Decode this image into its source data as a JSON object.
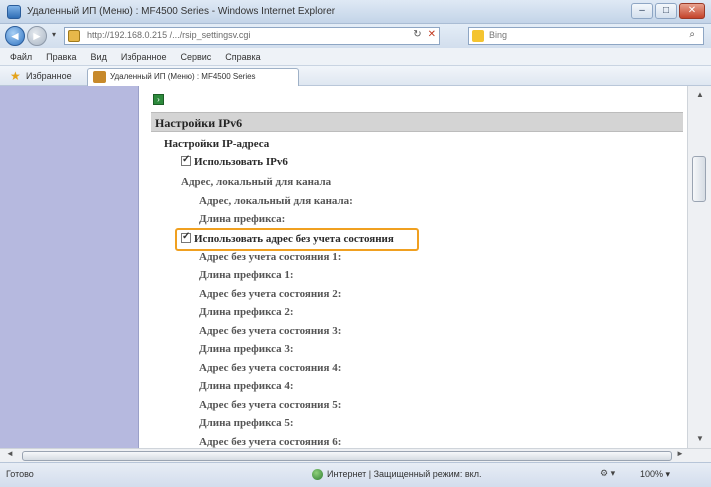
{
  "window": {
    "title": "Удаленный ИП (Меню) : MF4500 Series - Windows Internet Explorer",
    "min": "–",
    "max": "□",
    "close": "✕"
  },
  "nav": {
    "back": "◄",
    "forward": "►",
    "dropdown": "▾",
    "url": "http://192.168.0.215 /.../rsip_settingsv.cgi",
    "refresh": "↻",
    "stop": "✕",
    "search_placeholder": "Bing",
    "search_go": "⌕"
  },
  "menu": [
    "Файл",
    "Правка",
    "Вид",
    "Избранное",
    "Сервис",
    "Справка"
  ],
  "favorites": {
    "label": "Избранное",
    "tab_title": "Удаленный ИП (Меню) : MF4500 Series"
  },
  "page": {
    "section_title": "Настройки IPv6",
    "group_title": "Настройки IP-адреса",
    "use_ipv6": "Использовать IPv6",
    "link_local_heading": "Адрес, локальный для канала",
    "link_local_address": "Адрес, локальный для канала:",
    "prefix_length": "Длина префикса:",
    "use_stateless": "Использовать адрес без учета состояния",
    "stateless_rows": [
      "Адрес без учета состояния 1:",
      "Длина префикса 1:",
      "Адрес без учета состояния 2:",
      "Длина префикса 2:",
      "Адрес без учета состояния 3:",
      "Длина префикса 3:",
      "Адрес без учета состояния 4:",
      "Длина префикса 4:",
      "Адрес без учета состояния 5:",
      "Длина префикса 5:",
      "Адрес без учета состояния 6:"
    ]
  },
  "status": {
    "left": "Готово",
    "zone": "Интернет | Защищенный режим: вкл.",
    "tools": "⚙ ▾",
    "zoom": "100% ▾"
  },
  "colors": {
    "sidebar": "#b6b9df",
    "highlight": "#f0a020",
    "section_bg": "#d4d4d4"
  }
}
